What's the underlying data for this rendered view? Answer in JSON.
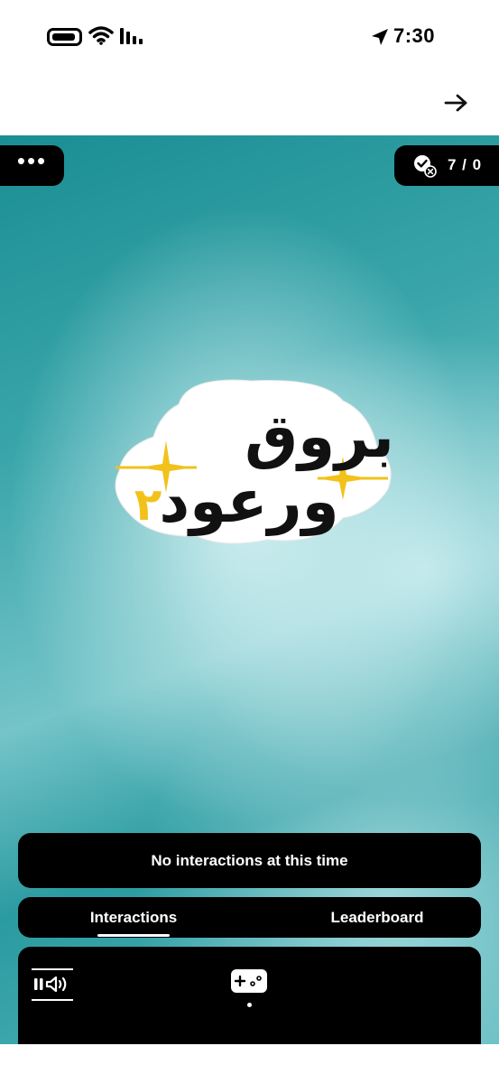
{
  "status_bar": {
    "time": "7:30",
    "icons": [
      "battery-icon",
      "wifi-icon",
      "signal-icon",
      "location-arrow-icon"
    ]
  },
  "header": {
    "back_icon": "arrow-right-icon"
  },
  "stage": {
    "menu_label": "•••",
    "score": "7 / 0",
    "score_icon": "check-badge-icon",
    "logo": {
      "line1": "بروق",
      "line2": "ورعود",
      "number": "٢"
    }
  },
  "notice": {
    "text": "No interactions at this time"
  },
  "tabs": [
    {
      "label": "Interactions",
      "active": true
    },
    {
      "label": "Leaderboard",
      "active": false
    }
  ],
  "controls": {
    "audio_icon": "pause-volume-icon",
    "game_icon": "gamepad-icon"
  },
  "colors": {
    "teal": "#1a8e93",
    "light_teal": "#bfe6e8",
    "accent_yellow": "#f2c21b",
    "panel": "#000000"
  }
}
